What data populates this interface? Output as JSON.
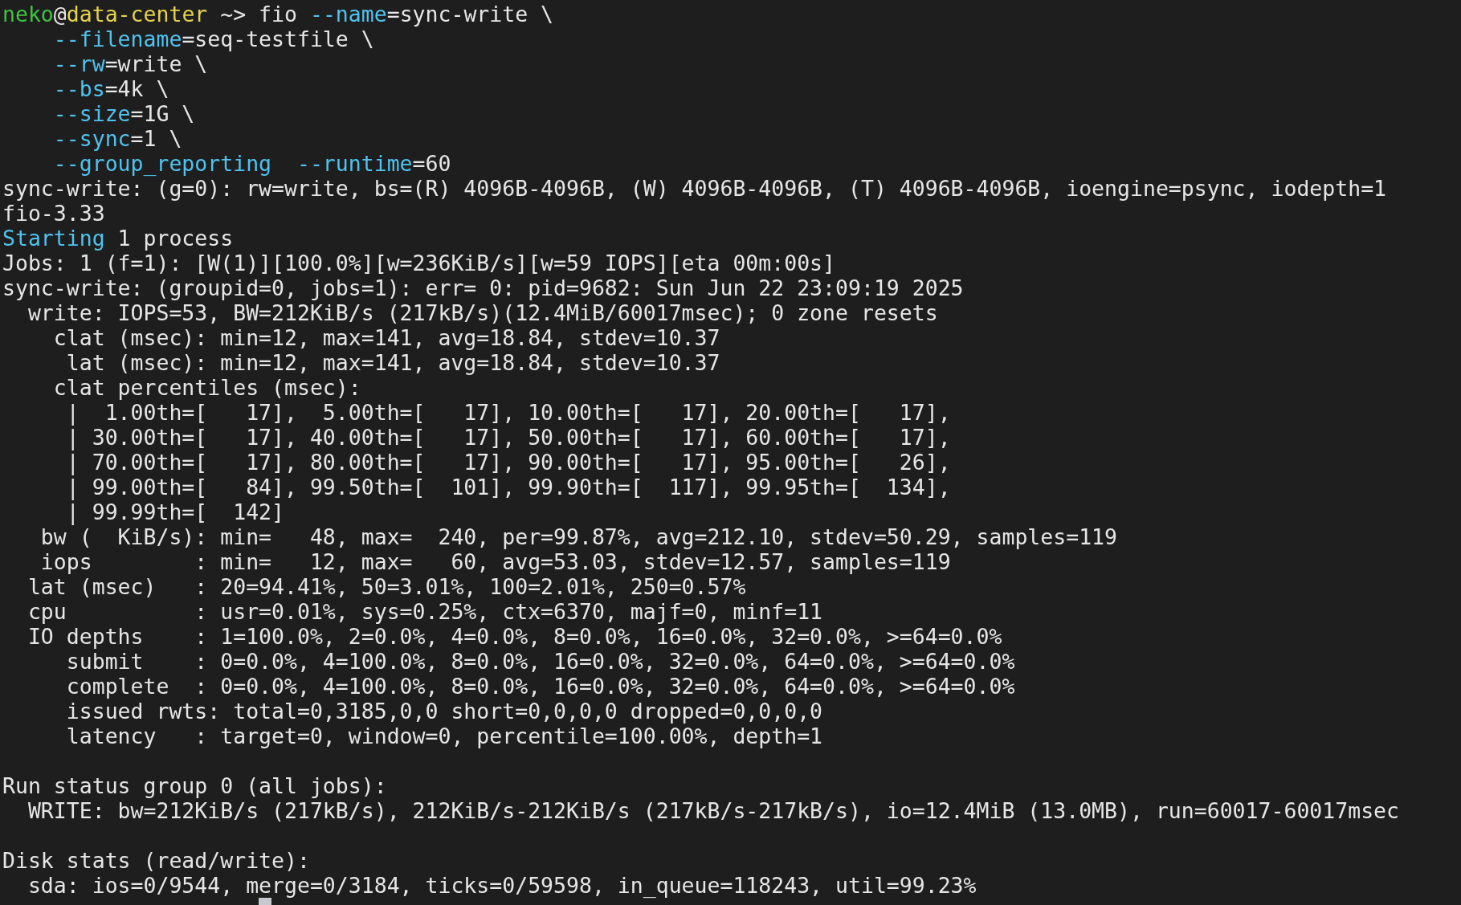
{
  "blocks": [
    {
      "lines": [
        {
          "segments": [
            {
              "kind": "user",
              "text": "neko"
            },
            {
              "kind": "plain",
              "text": "@"
            },
            {
              "kind": "host",
              "text": "data-center"
            },
            {
              "kind": "plain",
              "text": " ~> fio "
            },
            {
              "kind": "option",
              "text": "--name"
            },
            {
              "kind": "plain",
              "text": "=sync-write \\"
            }
          ]
        },
        {
          "segments": [
            {
              "kind": "option",
              "text": "    --filename"
            },
            {
              "kind": "plain",
              "text": "=seq-testfile \\"
            }
          ]
        },
        {
          "segments": [
            {
              "kind": "option",
              "text": "    --rw"
            },
            {
              "kind": "plain",
              "text": "=write \\"
            }
          ]
        },
        {
          "segments": [
            {
              "kind": "option",
              "text": "    --bs"
            },
            {
              "kind": "plain",
              "text": "=4k \\"
            }
          ]
        },
        {
          "segments": [
            {
              "kind": "option",
              "text": "    --size"
            },
            {
              "kind": "plain",
              "text": "=1G \\"
            }
          ]
        },
        {
          "segments": [
            {
              "kind": "option",
              "text": "    --sync"
            },
            {
              "kind": "plain",
              "text": "=1 \\"
            }
          ]
        },
        {
          "segments": [
            {
              "kind": "option",
              "text": "    --group_reporting  --runtime"
            },
            {
              "kind": "plain",
              "text": "=60"
            }
          ]
        },
        {
          "segments": [
            {
              "kind": "plain",
              "text": "sync-write: (g=0): rw=write, bs=(R) 4096B-4096B, (W) 4096B-4096B, (T) 4096B-4096B, ioengine=psync, iodepth=1"
            }
          ]
        },
        {
          "segments": [
            {
              "kind": "plain",
              "text": "fio-3.33"
            }
          ]
        },
        {
          "segments": [
            {
              "kind": "option",
              "text": "Starting"
            },
            {
              "kind": "plain",
              "text": " 1 process"
            }
          ]
        },
        {
          "segments": [
            {
              "kind": "plain",
              "text": "Jobs: 1 (f=1): [W(1)][100.0%][w=236KiB/s][w=59 IOPS][eta 00m:00s]"
            }
          ]
        },
        {
          "segments": [
            {
              "kind": "plain",
              "text": "sync-write: (groupid=0, jobs=1): err= 0: pid=9682: Sun Jun 22 23:09:19 2025"
            }
          ]
        },
        {
          "segments": [
            {
              "kind": "plain",
              "text": "  write: IOPS=53, BW=212KiB/s (217kB/s)(12.4MiB/60017msec); 0 zone resets"
            }
          ]
        },
        {
          "segments": [
            {
              "kind": "plain",
              "text": "    clat (msec): min=12, max=141, avg=18.84, stdev=10.37"
            }
          ]
        },
        {
          "segments": [
            {
              "kind": "plain",
              "text": "     lat (msec): min=12, max=141, avg=18.84, stdev=10.37"
            }
          ]
        },
        {
          "segments": [
            {
              "kind": "plain",
              "text": "    clat percentiles (msec):"
            }
          ]
        },
        {
          "segments": [
            {
              "kind": "plain",
              "text": "     |  1.00th=[   17],  5.00th=[   17], 10.00th=[   17], 20.00th=[   17],"
            }
          ]
        },
        {
          "segments": [
            {
              "kind": "plain",
              "text": "     | 30.00th=[   17], 40.00th=[   17], 50.00th=[   17], 60.00th=[   17],"
            }
          ]
        },
        {
          "segments": [
            {
              "kind": "plain",
              "text": "     | 70.00th=[   17], 80.00th=[   17], 90.00th=[   17], 95.00th=[   26],"
            }
          ]
        },
        {
          "segments": [
            {
              "kind": "plain",
              "text": "     | 99.00th=[   84], 99.50th=[  101], 99.90th=[  117], 99.95th=[  134],"
            }
          ]
        },
        {
          "segments": [
            {
              "kind": "plain",
              "text": "     | 99.99th=[  142]"
            }
          ]
        },
        {
          "segments": [
            {
              "kind": "plain",
              "text": "   bw (  KiB/s): min=   48, max=  240, per=99.87%, avg=212.10, stdev=50.29, samples=119"
            }
          ]
        },
        {
          "segments": [
            {
              "kind": "plain",
              "text": "   iops        : min=   12, max=   60, avg=53.03, stdev=12.57, samples=119"
            }
          ]
        },
        {
          "segments": [
            {
              "kind": "plain",
              "text": "  lat (msec)   : 20=94.41%, 50=3.01%, 100=2.01%, 250=0.57%"
            }
          ]
        },
        {
          "segments": [
            {
              "kind": "plain",
              "text": "  cpu          : usr=0.01%, sys=0.25%, ctx=6370, majf=0, minf=11"
            }
          ]
        },
        {
          "segments": [
            {
              "kind": "plain",
              "text": "  IO depths    : 1=100.0%, 2=0.0%, 4=0.0%, 8=0.0%, 16=0.0%, 32=0.0%, >=64=0.0%"
            }
          ]
        },
        {
          "segments": [
            {
              "kind": "plain",
              "text": "     submit    : 0=0.0%, 4=100.0%, 8=0.0%, 16=0.0%, 32=0.0%, 64=0.0%, >=64=0.0%"
            }
          ]
        },
        {
          "segments": [
            {
              "kind": "plain",
              "text": "     complete  : 0=0.0%, 4=100.0%, 8=0.0%, 16=0.0%, 32=0.0%, 64=0.0%, >=64=0.0%"
            }
          ]
        },
        {
          "segments": [
            {
              "kind": "plain",
              "text": "     issued rwts: total=0,3185,0,0 short=0,0,0,0 dropped=0,0,0,0"
            }
          ]
        },
        {
          "segments": [
            {
              "kind": "plain",
              "text": "     latency   : target=0, window=0, percentile=100.00%, depth=1"
            }
          ]
        }
      ]
    },
    {
      "lines": [
        {
          "segments": [
            {
              "kind": "plain",
              "text": "Run status group 0 (all jobs):"
            }
          ]
        },
        {
          "segments": [
            {
              "kind": "plain",
              "text": "  WRITE: bw=212KiB/s (217kB/s), 212KiB/s-212KiB/s (217kB/s-217kB/s), io=12.4MiB (13.0MB), run=60017-60017msec"
            }
          ]
        }
      ]
    },
    {
      "lines": [
        {
          "segments": [
            {
              "kind": "plain",
              "text": "Disk stats (read/write):"
            }
          ]
        },
        {
          "segments": [
            {
              "kind": "plain",
              "text": "  sda: ios=0/9544, merge=0/3184, ticks=0/59598, in_queue=118243, util=99.23%"
            }
          ]
        }
      ]
    }
  ],
  "cursor_visible": true
}
